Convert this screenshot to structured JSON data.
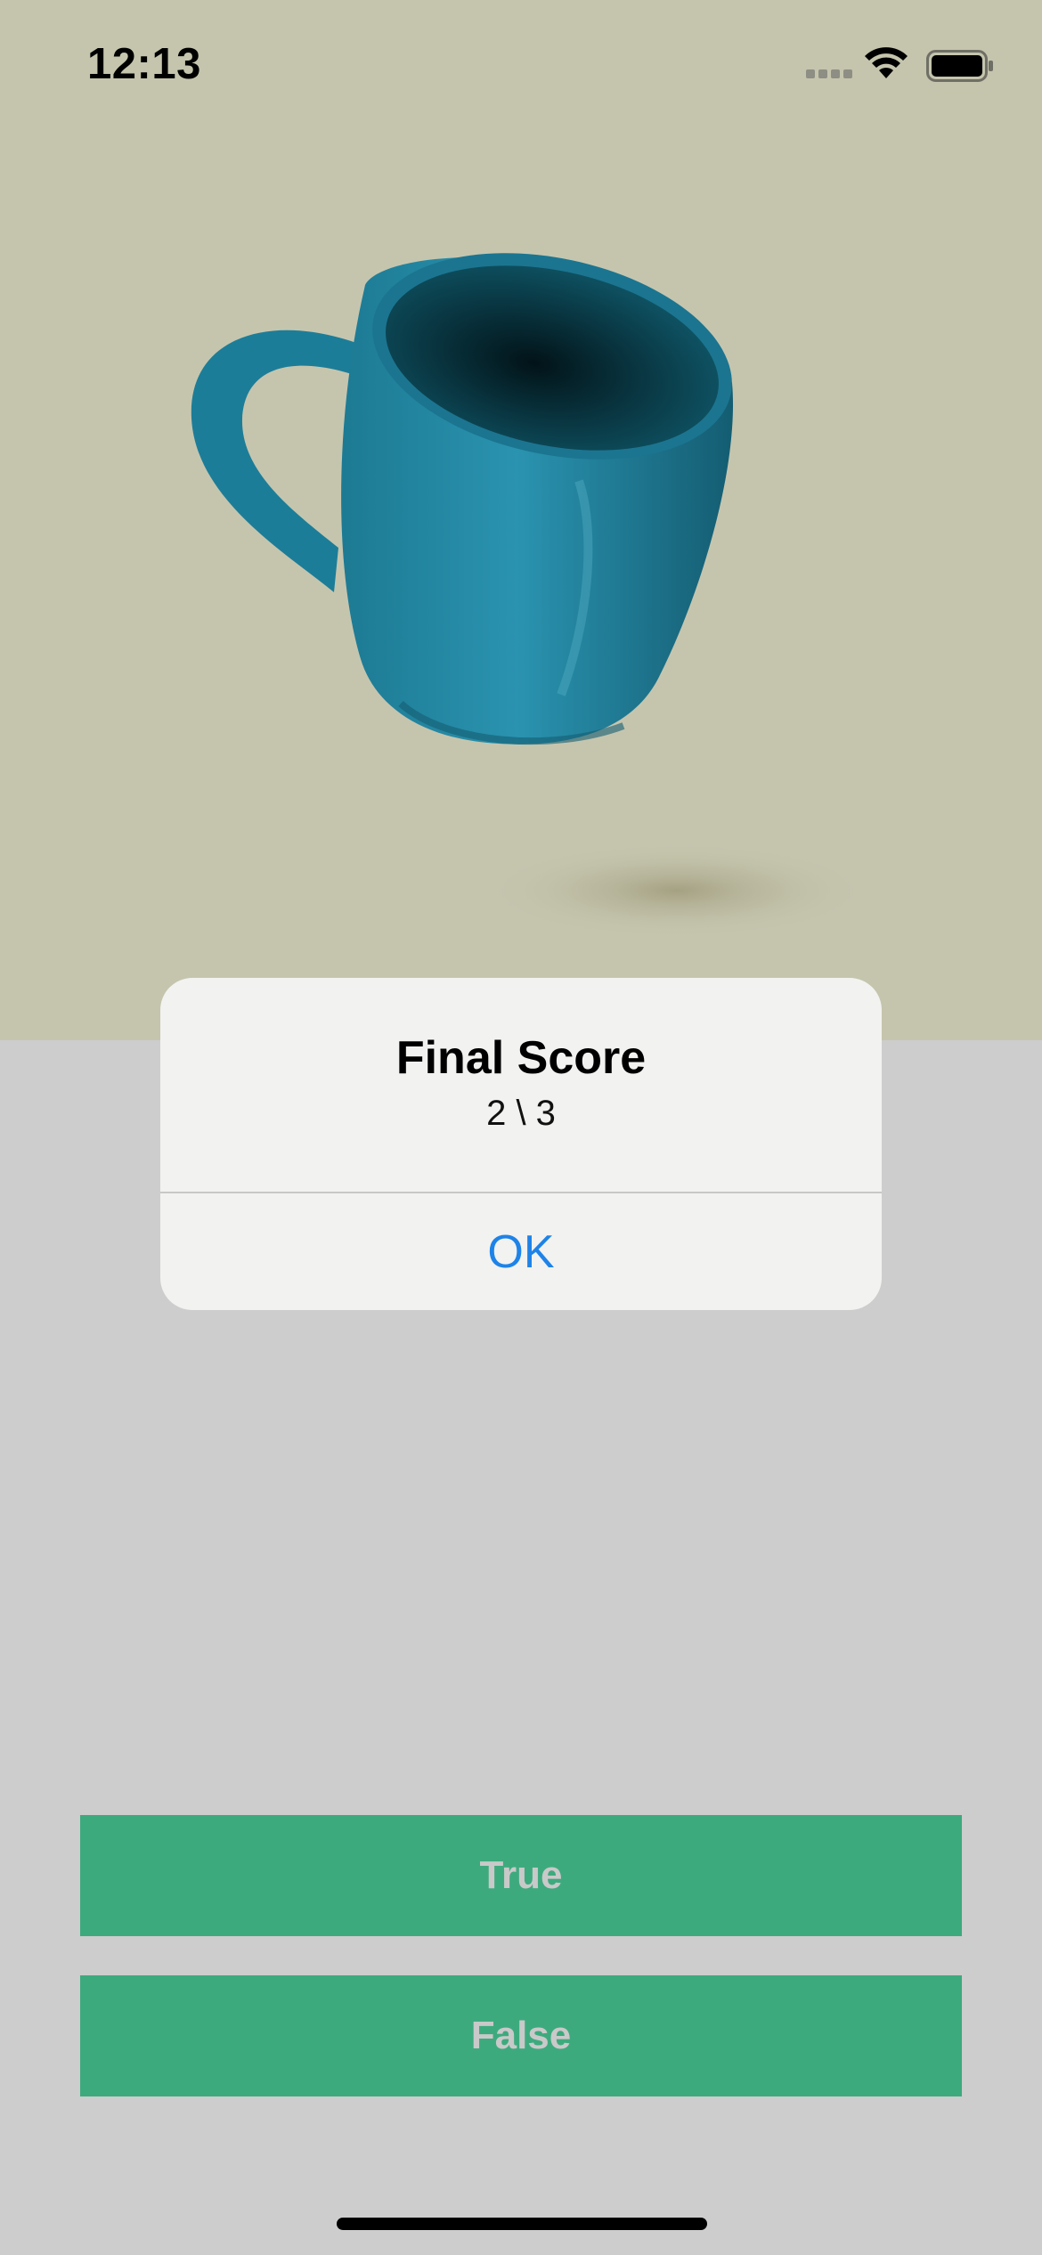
{
  "status_bar": {
    "time": "12:13",
    "icons": [
      "cellular-signal-icon",
      "wifi-icon",
      "battery-icon"
    ]
  },
  "question_image": {
    "subject": "mug",
    "colors": {
      "background": "#c5c5ae",
      "mug": "#1c7d98"
    }
  },
  "alert": {
    "title": "Final Score",
    "message": "2 \\ 3",
    "ok_label": "OK",
    "colors": {
      "button_text": "#1e83e8"
    }
  },
  "answers": {
    "true_label": "True",
    "false_label": "False",
    "colors": {
      "background": "#3daa7d",
      "text": "#c9c9c9"
    }
  }
}
